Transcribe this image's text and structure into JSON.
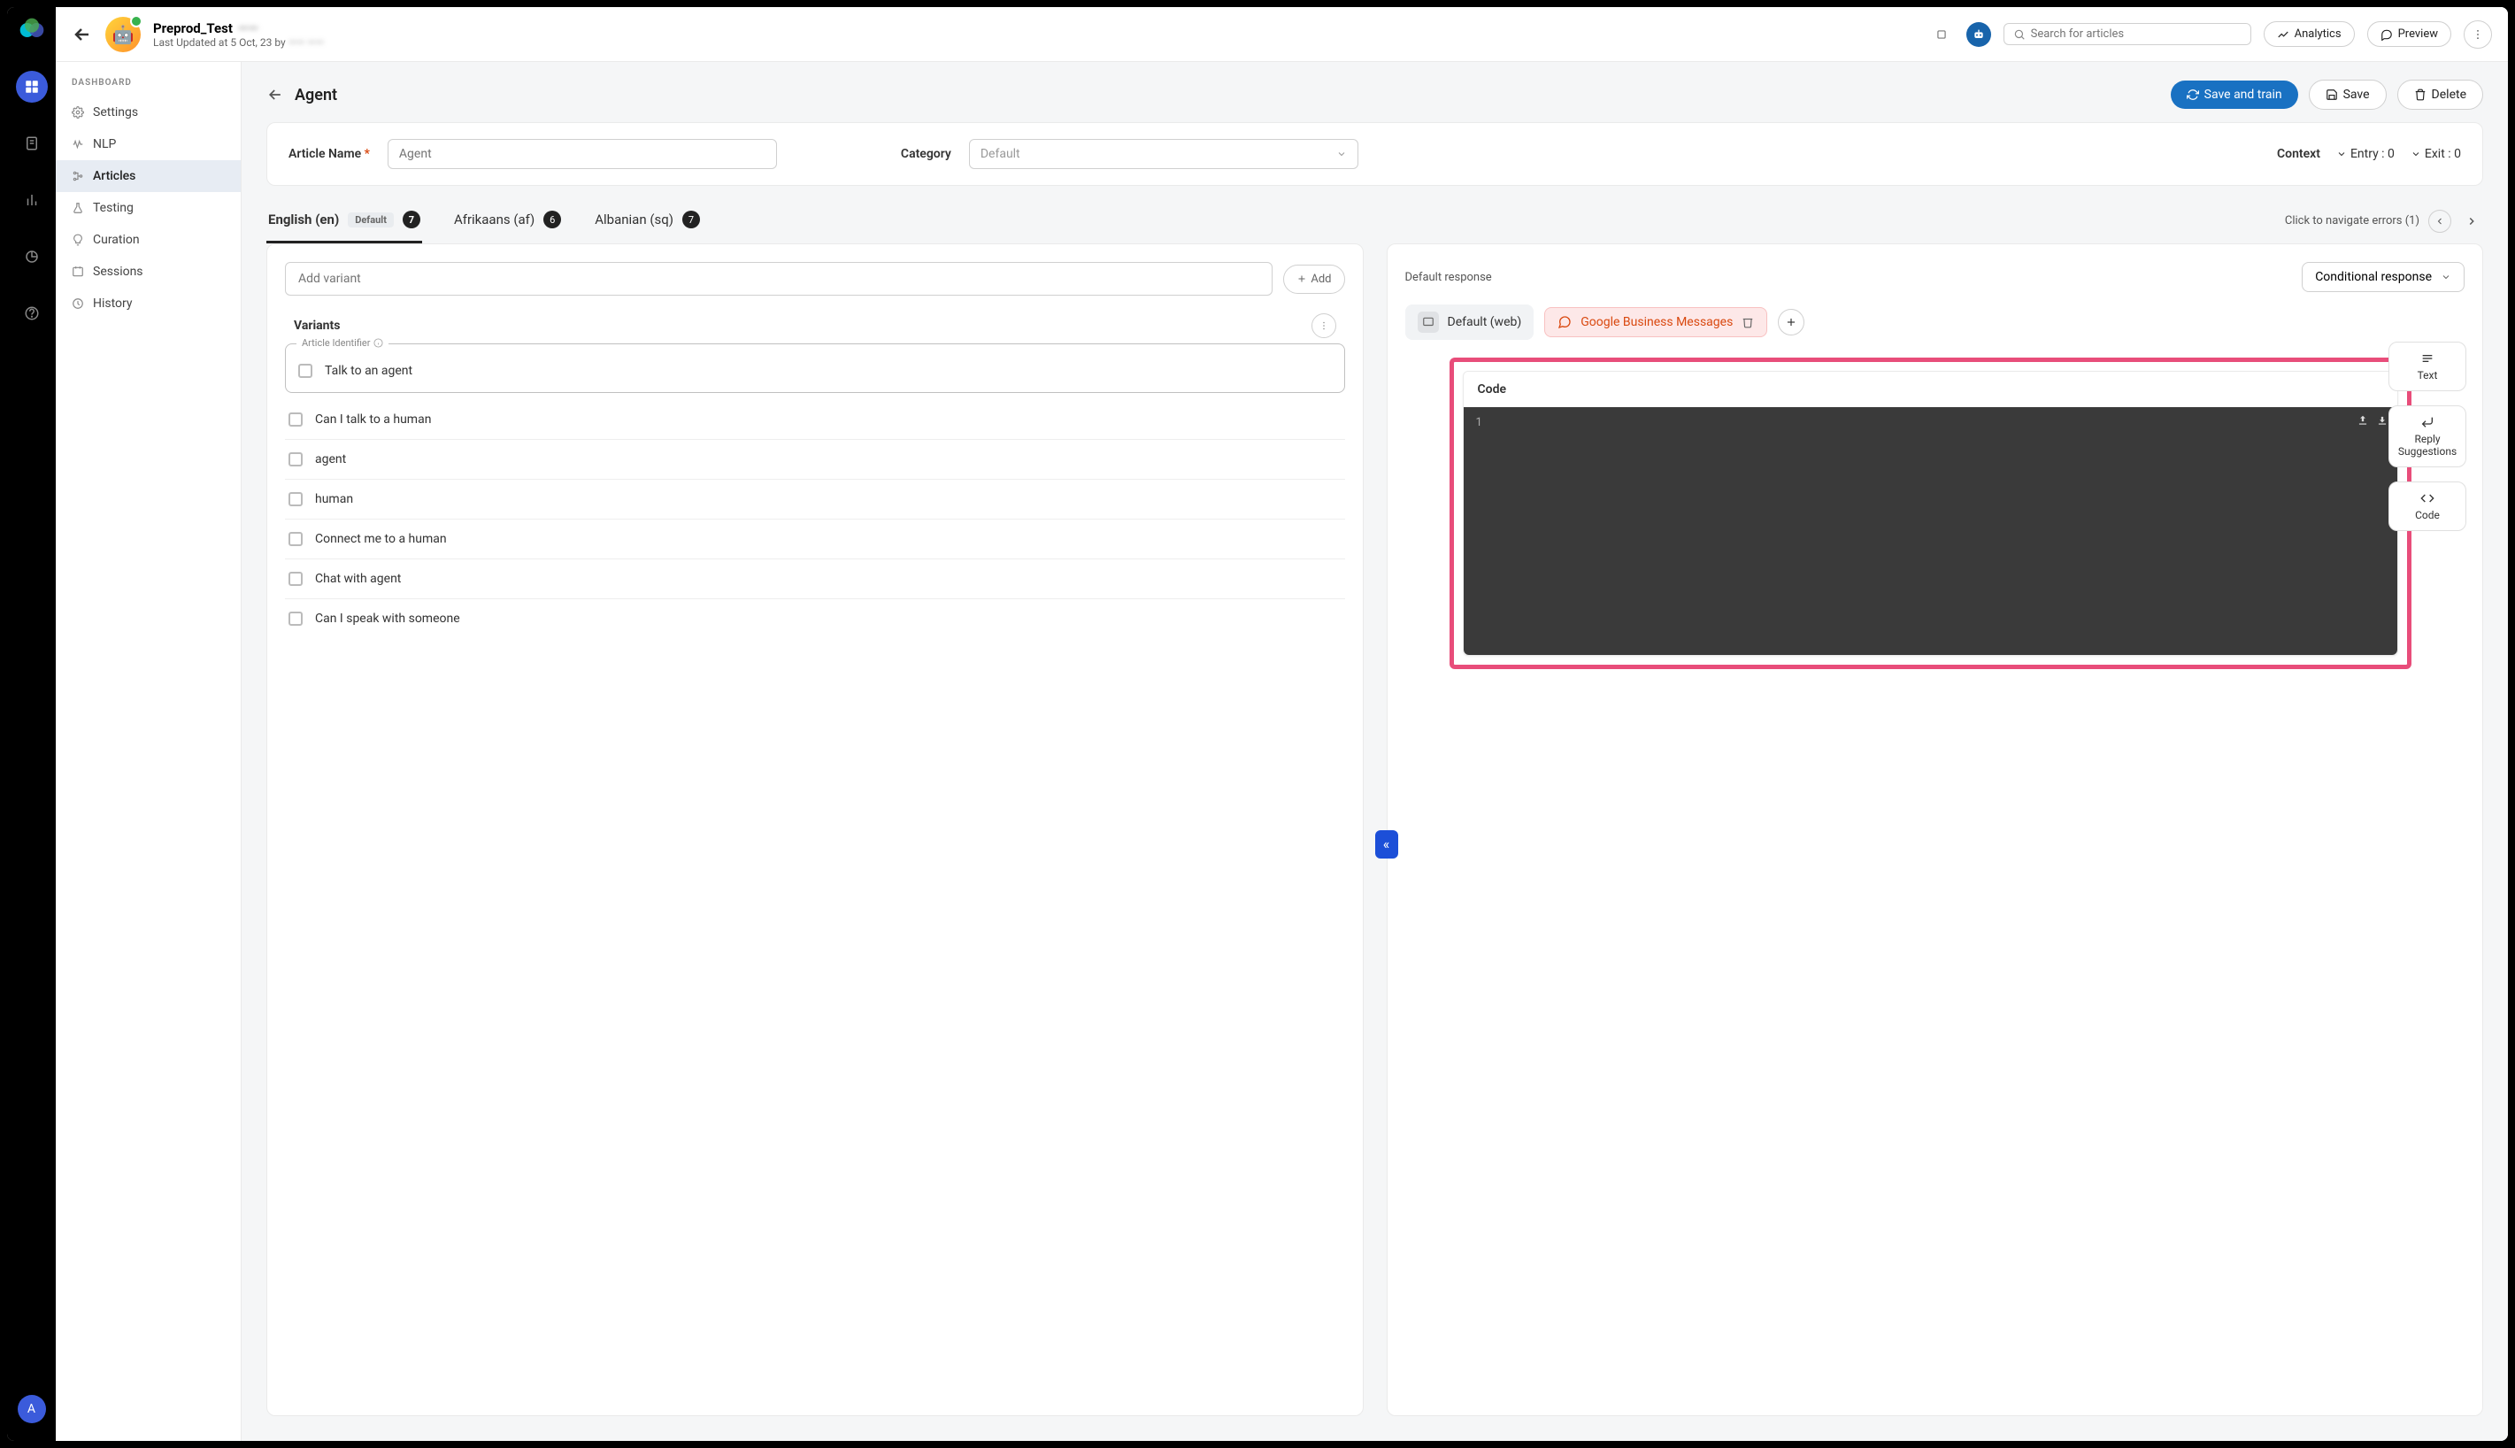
{
  "header": {
    "botName": "Preprod_Test",
    "botNameSuffix": "——",
    "lastUpdatedPrefix": "Last Updated at 5 Oct, 23 by ",
    "lastUpdatedAuthor": "—— ——",
    "searchPlaceholder": "Search for articles",
    "analytics": "Analytics",
    "preview": "Preview"
  },
  "sidebar": {
    "heading": "DASHBOARD",
    "items": [
      {
        "label": "Settings"
      },
      {
        "label": "NLP"
      },
      {
        "label": "Articles"
      },
      {
        "label": "Testing"
      },
      {
        "label": "Curation"
      },
      {
        "label": "Sessions"
      },
      {
        "label": "History"
      }
    ]
  },
  "breadcrumb": {
    "title": "Agent",
    "saveTrain": "Save and train",
    "save": "Save",
    "delete": "Delete"
  },
  "meta": {
    "articleNameLabel": "Article Name",
    "articleNamePlaceholder": "Agent",
    "categoryLabel": "Category",
    "categoryPlaceholder": "Default",
    "contextLabel": "Context",
    "entryLabel": "Entry : 0",
    "exitLabel": "Exit : 0"
  },
  "langs": [
    {
      "name": "English (en)",
      "default": "Default",
      "count": "7"
    },
    {
      "name": "Afrikaans (af)",
      "count": "6"
    },
    {
      "name": "Albanian (sq)",
      "count": "7"
    }
  ],
  "errorNav": "Click to navigate errors (1)",
  "variantsPanel": {
    "addPlaceholder": "Add variant",
    "addBtn": "Add",
    "heading": "Variants",
    "identifierLegend": "Article Identifier",
    "identifier": "Talk to an agent",
    "items": [
      "Can I talk to a human",
      "agent",
      "human",
      "Connect me to a human",
      "Chat with agent",
      "Can I speak with someone"
    ]
  },
  "responsePanel": {
    "defaultResponse": "Default response",
    "conditionalResponse": "Conditional response",
    "channelDefault": "Default (web)",
    "channelGBM": "Google Business Messages",
    "codeHeading": "Code",
    "codeLine": "1",
    "tools": {
      "text": "Text",
      "reply": "Reply Suggestions",
      "code": "Code"
    }
  },
  "avatarLetter": "A"
}
